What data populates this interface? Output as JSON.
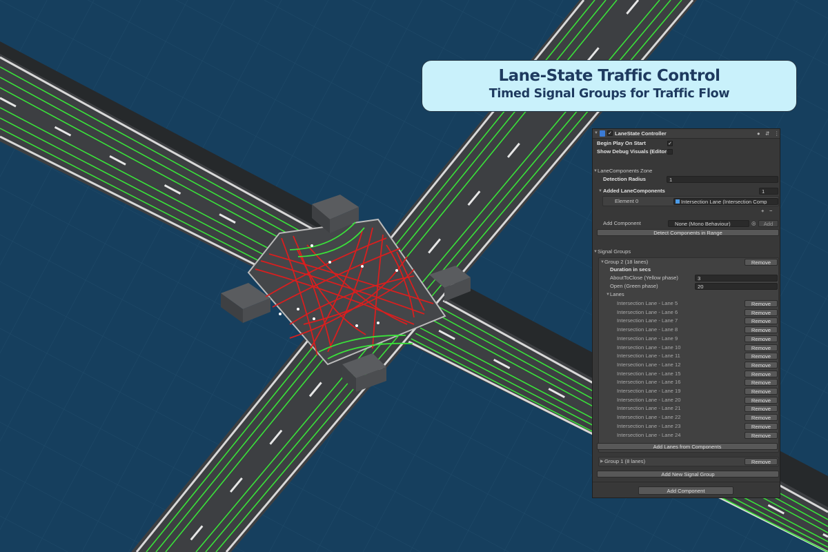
{
  "banner": {
    "title": "Lane-State Traffic Control",
    "subtitle": "Timed Signal Groups for Traffic Flow"
  },
  "colors": {
    "background": "#163f5e",
    "road": "#3d3f42",
    "lane_open": "#3ae23a",
    "lane_closed": "#d81f1f",
    "banner_bg": "#c9f1fb",
    "banner_text": "#1e3a5f",
    "panel_bg": "#383838"
  },
  "inspector": {
    "header": {
      "title": "LaneState Controller",
      "enabled": true,
      "icons": [
        "script-icon",
        "help-icon",
        "preset-icon",
        "more-icon"
      ]
    },
    "begin_play": {
      "label": "Begin Play On Start",
      "checked": true
    },
    "show_debug": {
      "label": "Show Debug Visuals (Editor-",
      "checked": false
    },
    "lane_zone": {
      "label": "LaneComponents Zone",
      "detection_radius_label": "Detection Radius",
      "detection_radius_value": "1",
      "added_label": "Added LaneComponents",
      "added_count": "1",
      "element0_label": "Element 0",
      "element0_value": "Intersection Lane (Intersection Comp",
      "plus": "+",
      "minus": "−",
      "add_component_label": "Add Component",
      "add_component_value": "None (Mono Behaviour)",
      "add_button": "Add",
      "detect_button": "Detect Components in Range"
    },
    "signal_groups": {
      "label": "Signal Groups",
      "group2": {
        "label": "Group 2 (18 lanes)",
        "remove": "Remove",
        "duration_label": "Duration in secs",
        "yellow_label": "AboutToClose (Yellow phase)",
        "yellow_value": "3",
        "green_label": "Open (Green phase)",
        "green_value": "20",
        "lanes_label": "Lanes",
        "lanes": [
          "Intersection Lane - Lane 5",
          "Intersection Lane - Lane 6",
          "Intersection Lane - Lane 7",
          "Intersection Lane - Lane 8",
          "Intersection Lane - Lane 9",
          "Intersection Lane - Lane 10",
          "Intersection Lane - Lane 11",
          "Intersection Lane - Lane 12",
          "Intersection Lane - Lane 15",
          "Intersection Lane - Lane 16",
          "Intersection Lane - Lane 19",
          "Intersection Lane - Lane 20",
          "Intersection Lane - Lane 21",
          "Intersection Lane - Lane 22",
          "Intersection Lane - Lane 23",
          "Intersection Lane - Lane 24"
        ],
        "lane_remove": "Remove",
        "add_lanes_button": "Add Lanes from Components"
      },
      "group1": {
        "label": "Group 1 (8 lanes)",
        "remove": "Remove"
      },
      "add_group_button": "Add New Signal Group"
    },
    "add_component_button": "Add Component"
  }
}
